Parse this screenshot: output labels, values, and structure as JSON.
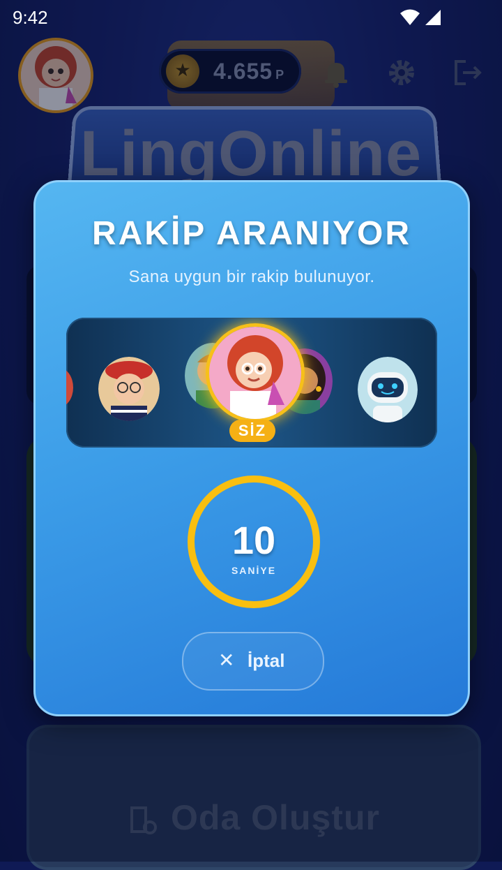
{
  "status_bar": {
    "time": "9:42"
  },
  "header": {
    "coins_value": "4.655",
    "coins_unit": "P",
    "icons": [
      "profile-avatar",
      "coin-star-icon",
      "notification-icon",
      "settings-gear-icon",
      "logout-icon"
    ]
  },
  "logo": {
    "text": "LingOnline"
  },
  "modal": {
    "title": "RAKİP ARANIYOR",
    "subtitle": "Sana uygun bir rakip bulunuyor.",
    "you_badge": "SİZ",
    "timer_value": "10",
    "timer_unit": "SANİYE",
    "cancel_label": "İptal",
    "avatars": [
      "beret-woman-avatar",
      "man-avatar",
      "scientist-girl-avatar",
      "woman-avatar",
      "robot-avatar"
    ]
  },
  "room_button": {
    "label": "Oda Oluştur"
  },
  "colors": {
    "modal_top": "#55b6f1",
    "modal_bottom": "#2479d8",
    "timer_ring": "#f9bf10",
    "badge": "#f5b015",
    "background": "#172470"
  }
}
